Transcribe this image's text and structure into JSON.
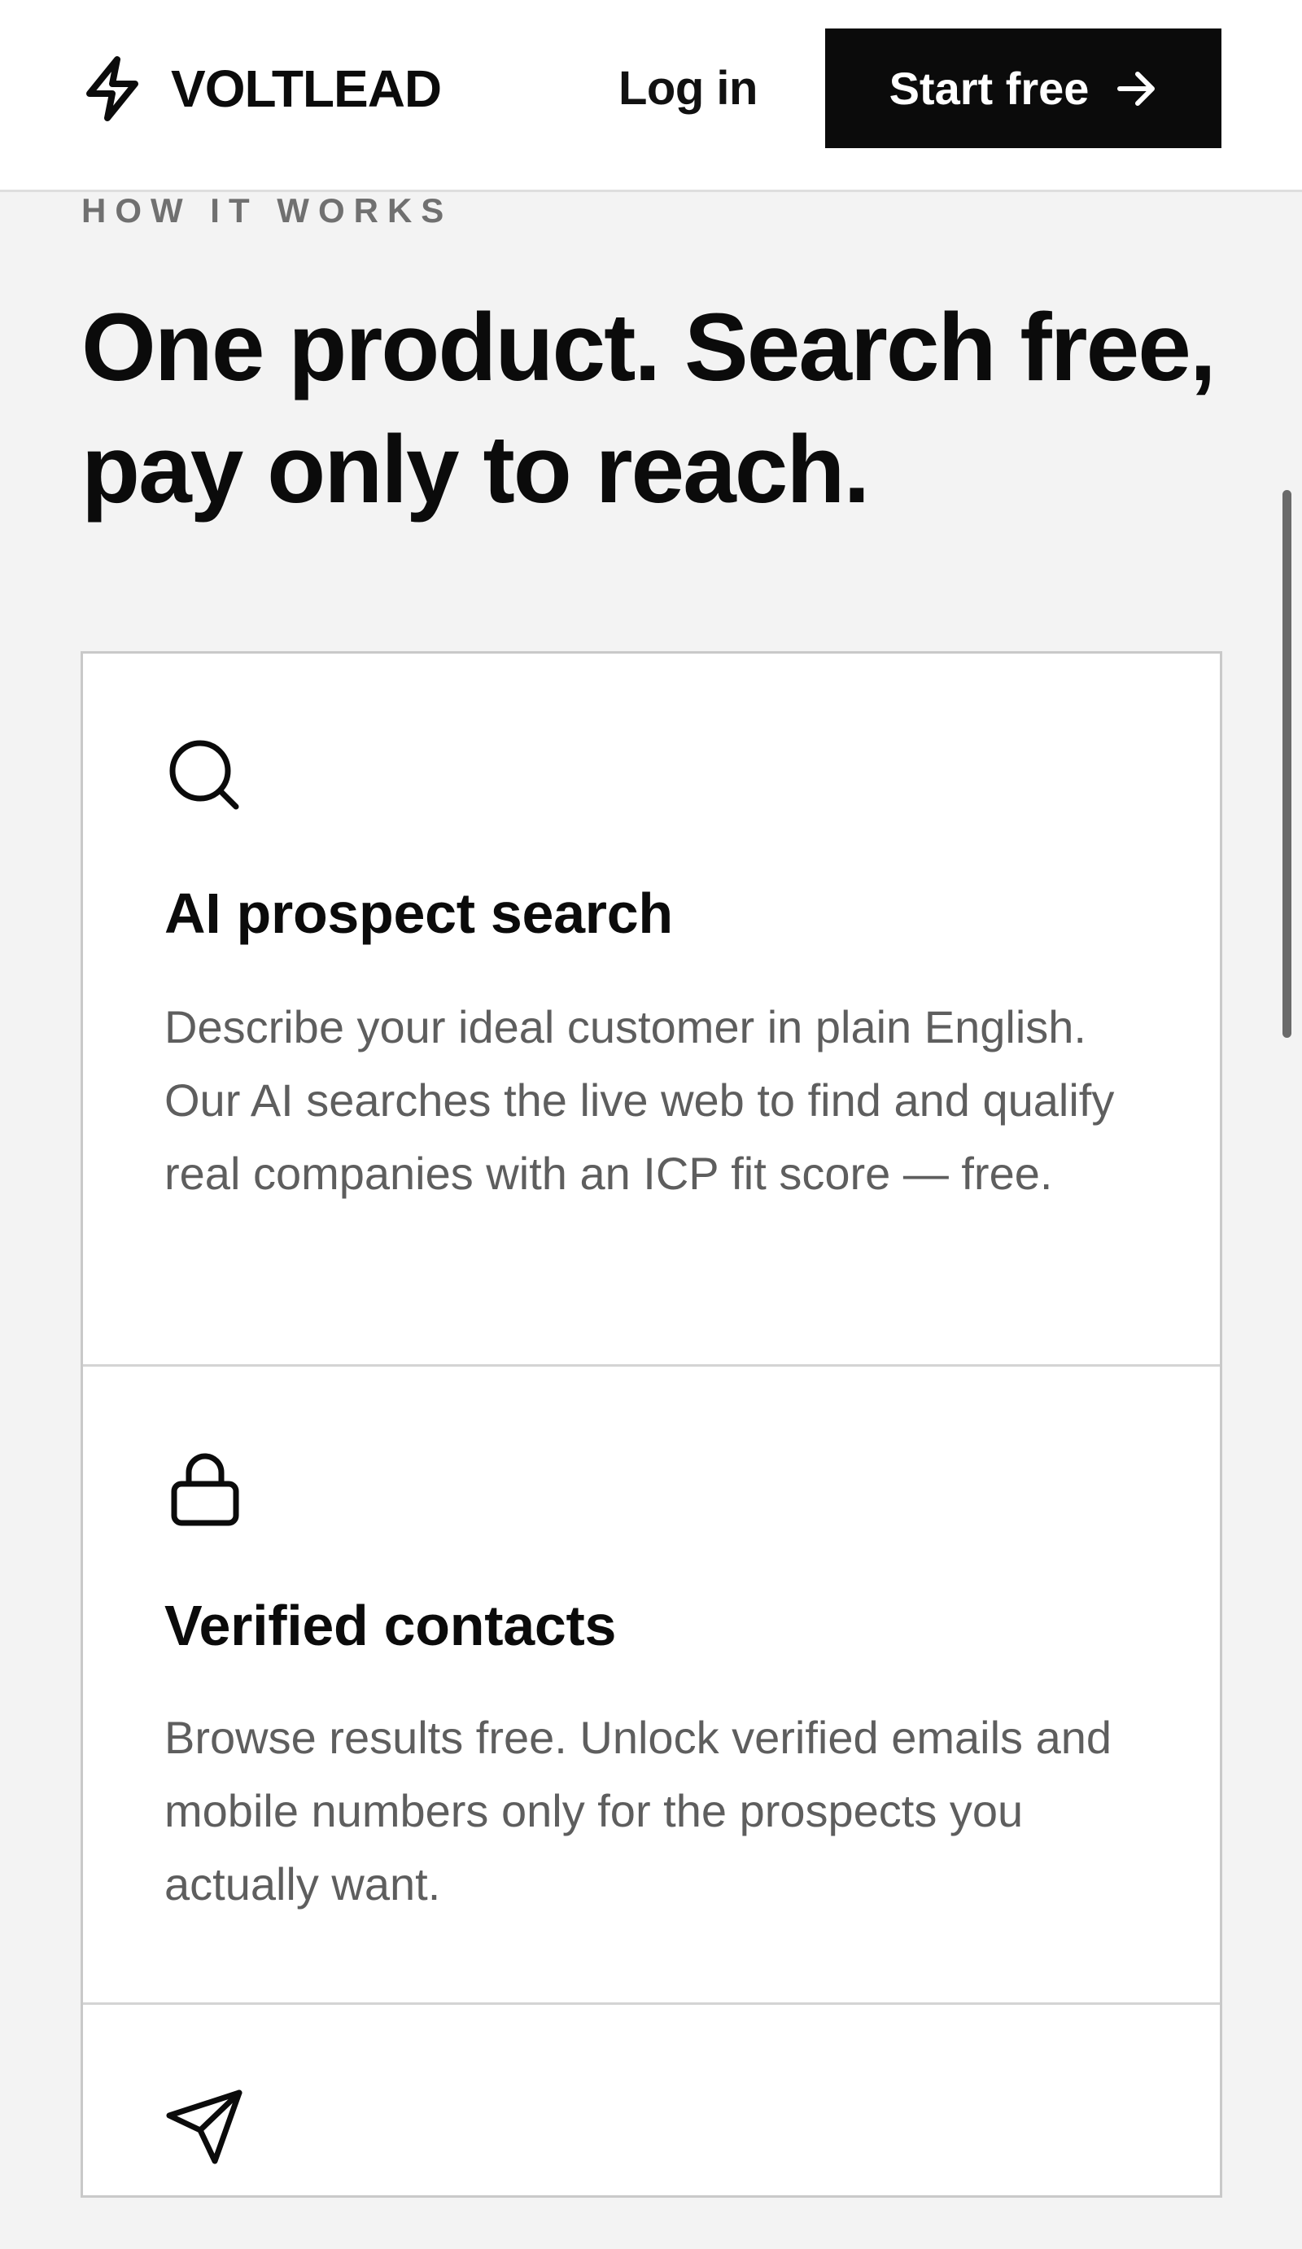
{
  "header": {
    "brand": "VOLTLEAD",
    "brand_icon": "lightning-bolt-icon",
    "login_label": "Log in",
    "cta_label": "Start free",
    "cta_icon": "arrow-right-icon"
  },
  "section": {
    "eyebrow": "HOW IT WORKS",
    "heading": "One product. Search free, pay only to reach."
  },
  "features": [
    {
      "icon": "search-icon",
      "title": "AI prospect search",
      "description": "Describe your ideal customer in plain English. Our AI searches the live web to find and qualify real companies with an ICP fit score — free."
    },
    {
      "icon": "lock-icon",
      "title": "Verified contacts",
      "description": "Browse results free. Unlock verified emails and mobile numbers only for the prospects you actually want."
    },
    {
      "icon": "send-icon"
    }
  ],
  "colors": {
    "page_background": "#f3f3f3",
    "primary_button": "#0b0b0b",
    "eyebrow_text": "#707070",
    "body_text": "#5e5e5e",
    "card_background": "#ffffff"
  }
}
